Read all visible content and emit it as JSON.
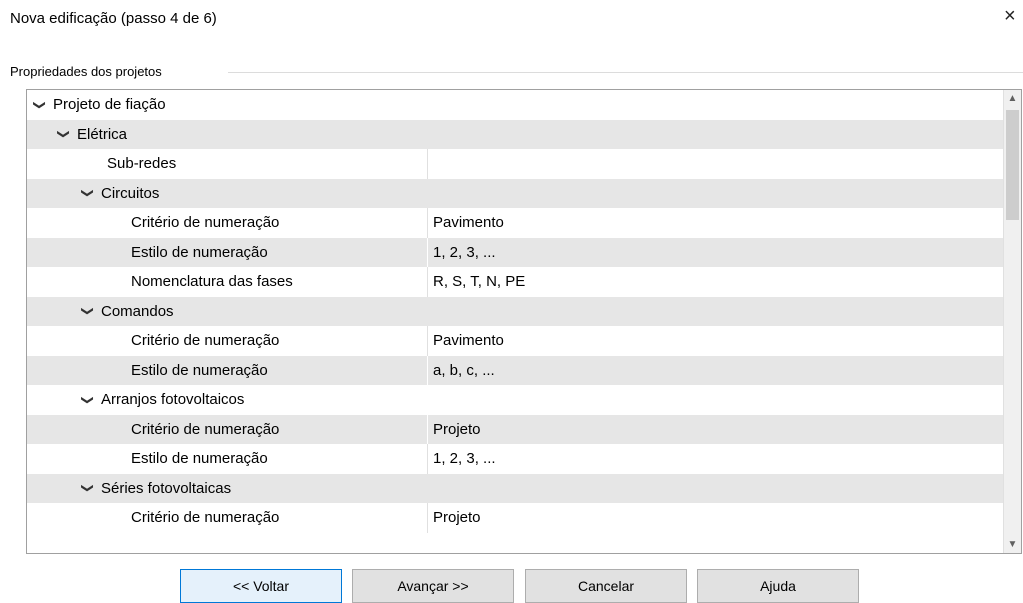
{
  "window": {
    "title": "Nova edificação (passo 4 de 6)",
    "close_glyph": "×"
  },
  "group": {
    "label": "Propriedades dos projetos"
  },
  "grid": {
    "rows": [
      {
        "kind": "category",
        "level": 0,
        "expanded": true,
        "name": "Projeto de fiação",
        "value": ""
      },
      {
        "kind": "category",
        "level": 1,
        "expanded": true,
        "name": "Elétrica",
        "value": ""
      },
      {
        "kind": "property",
        "level": 3,
        "name": "Sub-redes",
        "value": ""
      },
      {
        "kind": "category",
        "level": 2,
        "expanded": true,
        "name": "Circuitos",
        "value": ""
      },
      {
        "kind": "property",
        "level": 4,
        "name": "Critério de numeração",
        "value": "Pavimento"
      },
      {
        "kind": "property",
        "level": 4,
        "name": "Estilo de numeração",
        "value": "1, 2, 3, ..."
      },
      {
        "kind": "property",
        "level": 4,
        "name": "Nomenclatura das fases",
        "value": "R, S, T, N, PE"
      },
      {
        "kind": "category",
        "level": 2,
        "expanded": true,
        "name": "Comandos",
        "value": ""
      },
      {
        "kind": "property",
        "level": 4,
        "name": "Critério de numeração",
        "value": "Pavimento"
      },
      {
        "kind": "property",
        "level": 4,
        "name": "Estilo de numeração",
        "value": "a, b, c, ..."
      },
      {
        "kind": "category",
        "level": 2,
        "expanded": true,
        "name": "Arranjos fotovoltaicos",
        "value": ""
      },
      {
        "kind": "property",
        "level": 4,
        "name": "Critério de numeração",
        "value": "Projeto"
      },
      {
        "kind": "property",
        "level": 4,
        "name": "Estilo de numeração",
        "value": "1, 2, 3, ..."
      },
      {
        "kind": "category",
        "level": 2,
        "expanded": true,
        "name": "Séries fotovoltaicas",
        "value": ""
      },
      {
        "kind": "property",
        "level": 4,
        "name": "Critério de numeração",
        "value": "Projeto"
      }
    ],
    "scroll_up_glyph": "▲",
    "scroll_down_glyph": "▼",
    "chevron_glyph": "❯"
  },
  "buttons": {
    "back": "<< Voltar",
    "next": "Avançar  >>",
    "cancel": "Cancelar",
    "help": "Ajuda"
  },
  "colors": {
    "row_shade": "#e6e6e6",
    "active_button_border": "#0078d7",
    "active_button_bg": "#e5f1fb"
  }
}
